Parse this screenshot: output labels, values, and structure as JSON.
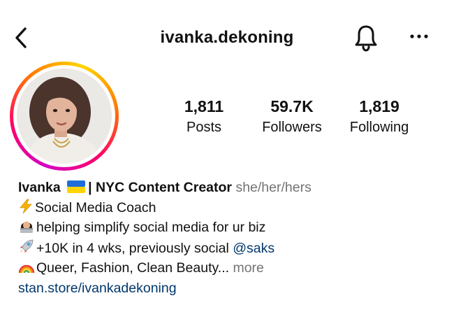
{
  "header": {
    "username": "ivanka.dekoning",
    "icons": {
      "back": "chevron-left-icon",
      "notifications": "bell-icon",
      "more": "more-horizontal-icon"
    }
  },
  "avatar": {
    "ring_colors": [
      "#d300c5",
      "#ff0069",
      "#ff7a00",
      "#ffd600"
    ]
  },
  "stats": [
    {
      "value": "1,811",
      "label": "Posts"
    },
    {
      "value": "59.7K",
      "label": "Followers"
    },
    {
      "value": "1,819",
      "label": "Following"
    }
  ],
  "bio": {
    "name_part1": "Ivanka",
    "name_part2": "| NYC Content Creator",
    "pronouns": "she/her/hers",
    "line1": "Social Media Coach",
    "line2": "helping simplify social media for ur biz",
    "line3_text": "+10K in 4 wks, previously social ",
    "line3_mention": "@saks",
    "line4_text": "Queer, Fashion, Clean Beauty... ",
    "more_label": "more",
    "website": "stan.store/ivankadekoning",
    "icons": [
      "ukraine-flag-icon",
      "lightning-icon",
      "technologist-icon",
      "rocket-icon",
      "rainbow-icon"
    ]
  },
  "colors": {
    "link": "#00376b",
    "muted": "#737373",
    "text": "#111111"
  }
}
